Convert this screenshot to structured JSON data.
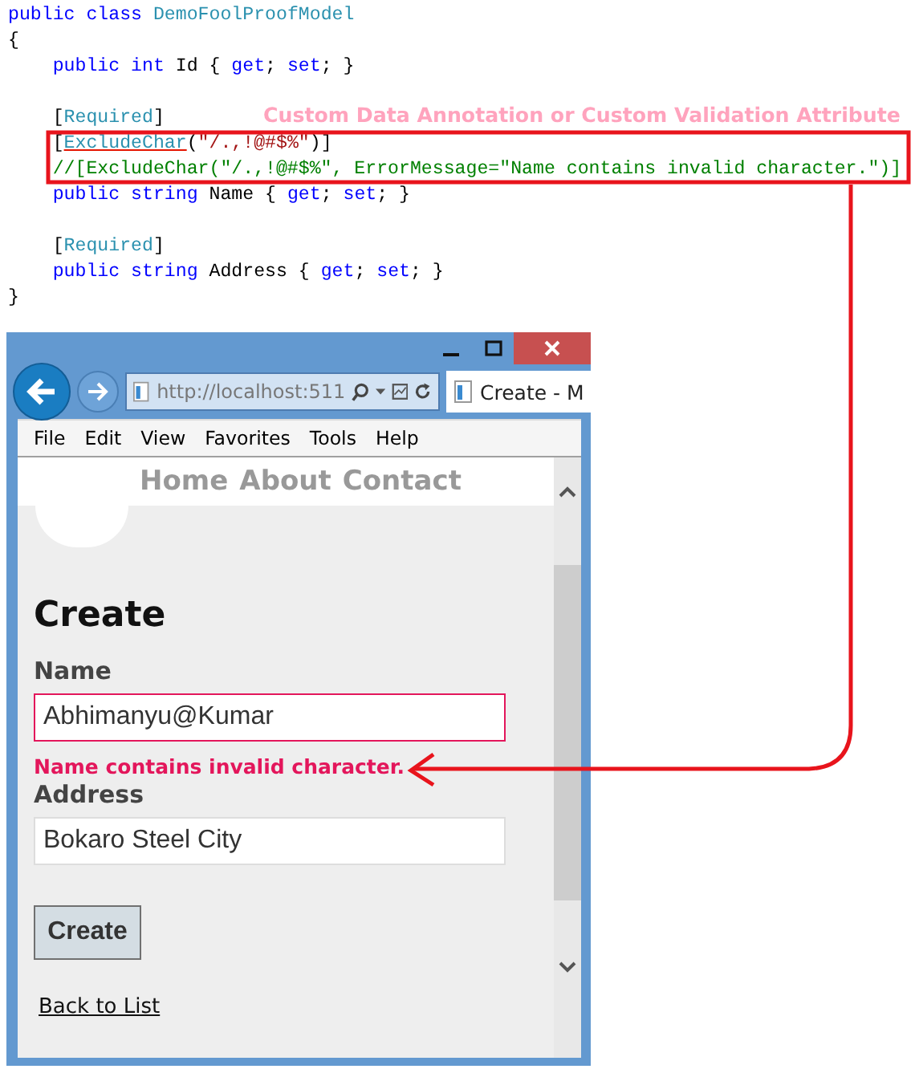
{
  "code_editor": {
    "lines": [
      {
        "gap_before": false,
        "tokens": [
          {
            "text": "public class ",
            "kind": "keyword"
          },
          {
            "text": "DemoFoolProofModel",
            "kind": "type"
          }
        ]
      },
      {
        "gap_before": false,
        "tokens": [
          {
            "text": "{",
            "kind": "plain"
          }
        ]
      },
      {
        "gap_before": false,
        "tokens": [
          {
            "text": "    public int ",
            "kind": "keyword"
          },
          {
            "text": "Id { ",
            "kind": "plain"
          },
          {
            "text": "get",
            "kind": "keyword"
          },
          {
            "text": "; ",
            "kind": "plain"
          },
          {
            "text": "set",
            "kind": "keyword"
          },
          {
            "text": "; }",
            "kind": "plain"
          }
        ]
      },
      {
        "gap_before": true,
        "tokens": [
          {
            "text": "    [",
            "kind": "plain"
          },
          {
            "text": "Required",
            "kind": "type"
          },
          {
            "text": "]",
            "kind": "plain"
          }
        ]
      },
      {
        "gap_before": false,
        "tokens": [
          {
            "text": "    [",
            "kind": "plain"
          },
          {
            "text": "ExcludeChar",
            "kind": "unresolved_type"
          },
          {
            "text": "(",
            "kind": "plain"
          },
          {
            "text": "\"/.,!@#$%\"",
            "kind": "string"
          },
          {
            "text": ")]",
            "kind": "plain"
          }
        ]
      },
      {
        "gap_before": false,
        "tokens": [
          {
            "text": "    //[ExcludeChar(\"/.,!@#$%\", ErrorMessage=\"Name contains invalid character.\")]",
            "kind": "comment"
          }
        ]
      },
      {
        "gap_before": false,
        "tokens": [
          {
            "text": "    public string ",
            "kind": "keyword"
          },
          {
            "text": "Name { ",
            "kind": "plain"
          },
          {
            "text": "get",
            "kind": "keyword"
          },
          {
            "text": "; ",
            "kind": "plain"
          },
          {
            "text": "set",
            "kind": "keyword"
          },
          {
            "text": "; }",
            "kind": "plain"
          }
        ]
      },
      {
        "gap_before": true,
        "tokens": [
          {
            "text": "    [",
            "kind": "plain"
          },
          {
            "text": "Required",
            "kind": "type"
          },
          {
            "text": "]",
            "kind": "plain"
          }
        ]
      },
      {
        "gap_before": false,
        "tokens": [
          {
            "text": "    public string ",
            "kind": "keyword"
          },
          {
            "text": "Address { ",
            "kind": "plain"
          },
          {
            "text": "get",
            "kind": "keyword"
          },
          {
            "text": "; ",
            "kind": "plain"
          },
          {
            "text": "set",
            "kind": "keyword"
          },
          {
            "text": "; }",
            "kind": "plain"
          }
        ]
      },
      {
        "gap_before": false,
        "tokens": [
          {
            "text": "}",
            "kind": "plain"
          }
        ]
      }
    ]
  },
  "annotation": {
    "label": "Custom Data Annotation or Custom Validation Attribute"
  },
  "browser": {
    "address": "http://localhost:511",
    "tab_title": "Create - M",
    "menu": [
      "File",
      "Edit",
      "View",
      "Favorites",
      "Tools",
      "Help"
    ],
    "nav_links": [
      "Home",
      "About",
      "Contact"
    ],
    "page": {
      "heading": "Create",
      "fields": [
        {
          "label": "Name",
          "value": "Abhimanyu@Kumar",
          "invalid": true,
          "error": "Name contains invalid character."
        },
        {
          "label": "Address",
          "value": "Bokaro Steel City",
          "invalid": false
        }
      ],
      "submit": "Create",
      "back_link": "Back to List"
    }
  }
}
